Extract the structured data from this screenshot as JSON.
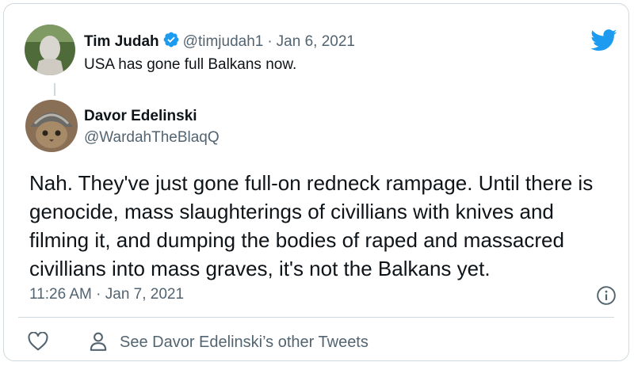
{
  "quoted_tweet": {
    "author_name": "Tim Judah",
    "verified_icon": "verified-badge-icon",
    "handle": "@timjudah1",
    "separator": "·",
    "date": "Jan 6, 2021",
    "text": "USA has gone full Balkans now."
  },
  "reply_tweet": {
    "author_name": "Davor Edelinski",
    "handle": "@WardahTheBlaqQ",
    "text": "Nah. They've just gone full-on redneck rampage. Until there is genocide, mass slaughterings of civillians with knives and filming it, and dumping the bodies of raped and massacred civillians into mass graves, it's not the Balkans yet.",
    "timestamp": "11:26 AM · Jan 7, 2021"
  },
  "footer": {
    "like_icon": "heart-icon",
    "profile_icon": "person-icon",
    "other_tweets_link": "See Davor Edelinski’s other Tweets"
  },
  "icons": {
    "logo": "twitter-bird-icon",
    "info": "info-icon"
  },
  "colors": {
    "brand_blue": "#1d9bf0",
    "secondary_text": "#536471",
    "border": "#cfd9de"
  }
}
